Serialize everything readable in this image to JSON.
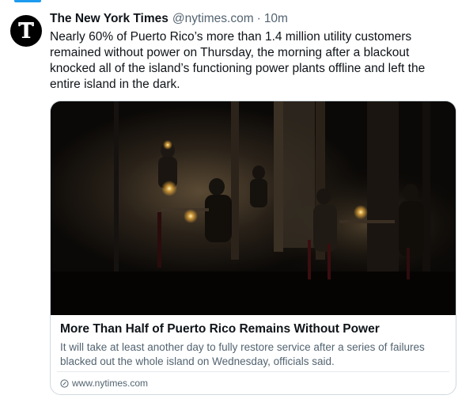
{
  "tweet": {
    "author_name": "The New York Times",
    "handle": "@nytimes.com",
    "separator": "·",
    "time": "10m",
    "text": "Nearly 60% of Puerto Rico’s more than 1.4 million utility customers remained without power on Thursday, the morning after a blackout knocked all of the island’s functioning power plants offline and left the entire island in the dark.",
    "avatar_icon": "nyt-logo-icon"
  },
  "card": {
    "title": "More Than Half of Puerto Rico Remains Without Power",
    "description": "It will take at least another day to fully restore service after a series of failures blacked out the whole island on Wednesday, officials said.",
    "source": "www.nytimes.com",
    "source_icon": "link-globe-icon",
    "image_subject": "people dining by candlelight at outdoor tables at night"
  },
  "colors": {
    "accent": "#1d9bf0",
    "text_primary": "#0f1419",
    "text_secondary": "#536471",
    "border": "#cfd9de"
  }
}
